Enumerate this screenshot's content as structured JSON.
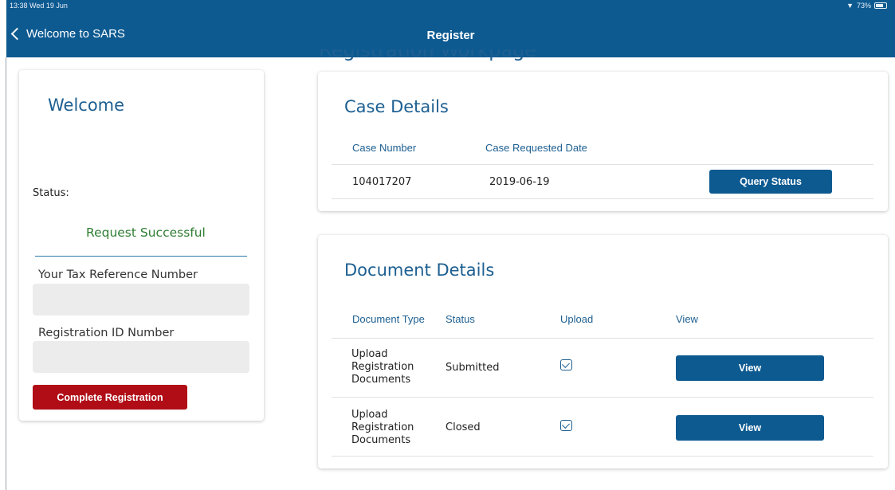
{
  "status_bar": {
    "time": "13:38  Wed 19 Jun",
    "battery": "73%"
  },
  "nav": {
    "back_label": "Welcome to SARS",
    "title": "Register"
  },
  "page_heading": "Registration Workpage",
  "left_panel": {
    "welcome": "Welcome",
    "status_label": "Status:",
    "status_value": "Request Successful",
    "tax_ref_label": "Your Tax Reference Number",
    "tax_ref_value": "",
    "reg_id_label": "Registration ID Number",
    "reg_id_value": "",
    "complete_button": "Complete Registration"
  },
  "case_details": {
    "title": "Case Details",
    "headers": [
      "Case Number",
      "Case Requested Date"
    ],
    "rows": [
      {
        "case_number": "104017207",
        "requested_date": "2019-06-19",
        "action": "Query Status"
      }
    ]
  },
  "document_details": {
    "title": "Document Details",
    "headers": [
      "Document Type",
      "Status",
      "Upload",
      "View"
    ],
    "rows": [
      {
        "type_line1": "Upload",
        "type_line2": "Registration",
        "type_line3": "Documents",
        "status": "Submitted",
        "uploaded": true,
        "view_label": "View"
      },
      {
        "type_line1": "Upload",
        "type_line2": "Registration",
        "type_line3": "Documents",
        "status": "Closed",
        "uploaded": true,
        "view_label": "View"
      }
    ]
  },
  "colors": {
    "primary": "#0d5a91",
    "danger": "#b00d17",
    "success": "#2e7d32"
  }
}
